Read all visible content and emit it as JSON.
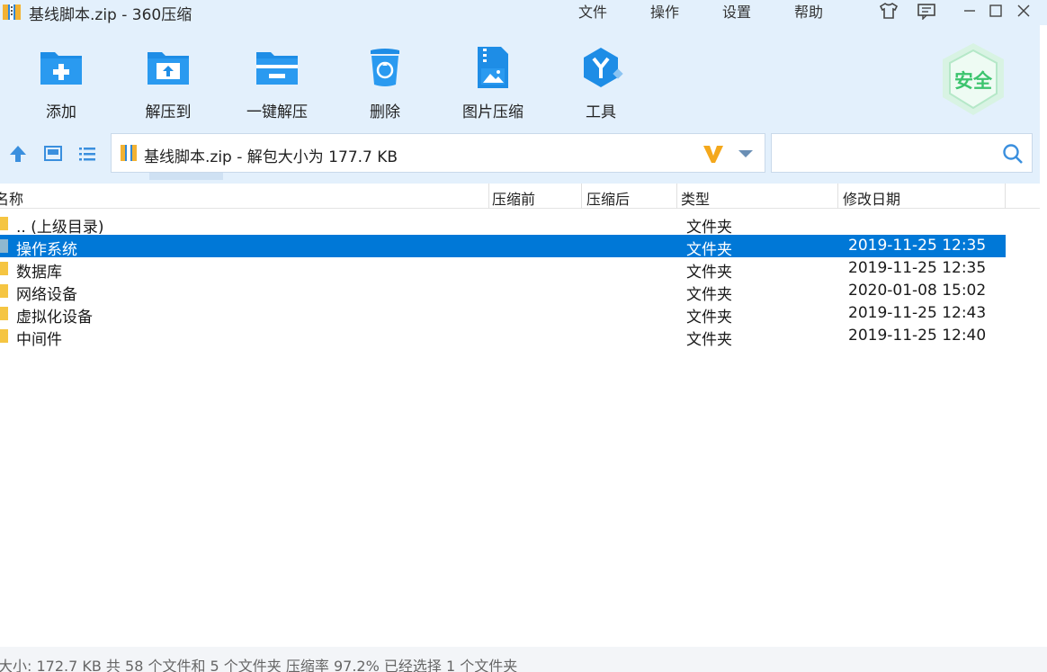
{
  "window": {
    "title": "基线脚本.zip - 360压缩",
    "menu": [
      "文件",
      "操作",
      "设置",
      "帮助"
    ]
  },
  "toolbar": {
    "buttons": [
      {
        "label": "添加",
        "icon": "add-icon"
      },
      {
        "label": "解压到",
        "icon": "extract-to-icon"
      },
      {
        "label": "一键解压",
        "icon": "one-click-extract-icon"
      },
      {
        "label": "删除",
        "icon": "delete-icon"
      },
      {
        "label": "图片压缩",
        "icon": "image-compress-icon"
      },
      {
        "label": "工具",
        "icon": "tools-icon"
      }
    ],
    "security_badge": "安全"
  },
  "address": {
    "path": "基线脚本.zip - 解包大小为 177.7 KB",
    "search_placeholder": ""
  },
  "columns": [
    "名称",
    "压缩前",
    "压缩后",
    "类型",
    "修改日期"
  ],
  "files": [
    {
      "name": ".. (上级目录)",
      "type": "文件夹",
      "date": "",
      "selected": false
    },
    {
      "name": "操作系统",
      "type": "文件夹",
      "date": "2019-11-25 12:35",
      "selected": true
    },
    {
      "name": "数据库",
      "type": "文件夹",
      "date": "2019-11-25 12:35",
      "selected": false
    },
    {
      "name": "网络设备",
      "type": "文件夹",
      "date": "2020-01-08 15:02",
      "selected": false
    },
    {
      "name": "虚拟化设备",
      "type": "文件夹",
      "date": "2019-11-25 12:43",
      "selected": false
    },
    {
      "name": "中间件",
      "type": "文件夹",
      "date": "2019-11-25 12:40",
      "selected": false
    }
  ],
  "status": "大小: 172.7 KB 共 58 个文件和 5 个文件夹 压缩率 97.2% 已经选择 1 个文件夹",
  "colors": {
    "accent": "#1e8de6",
    "selection": "#0078d7",
    "chrome_bg": "#e3f0fc",
    "security_green": "#3cc46e"
  }
}
